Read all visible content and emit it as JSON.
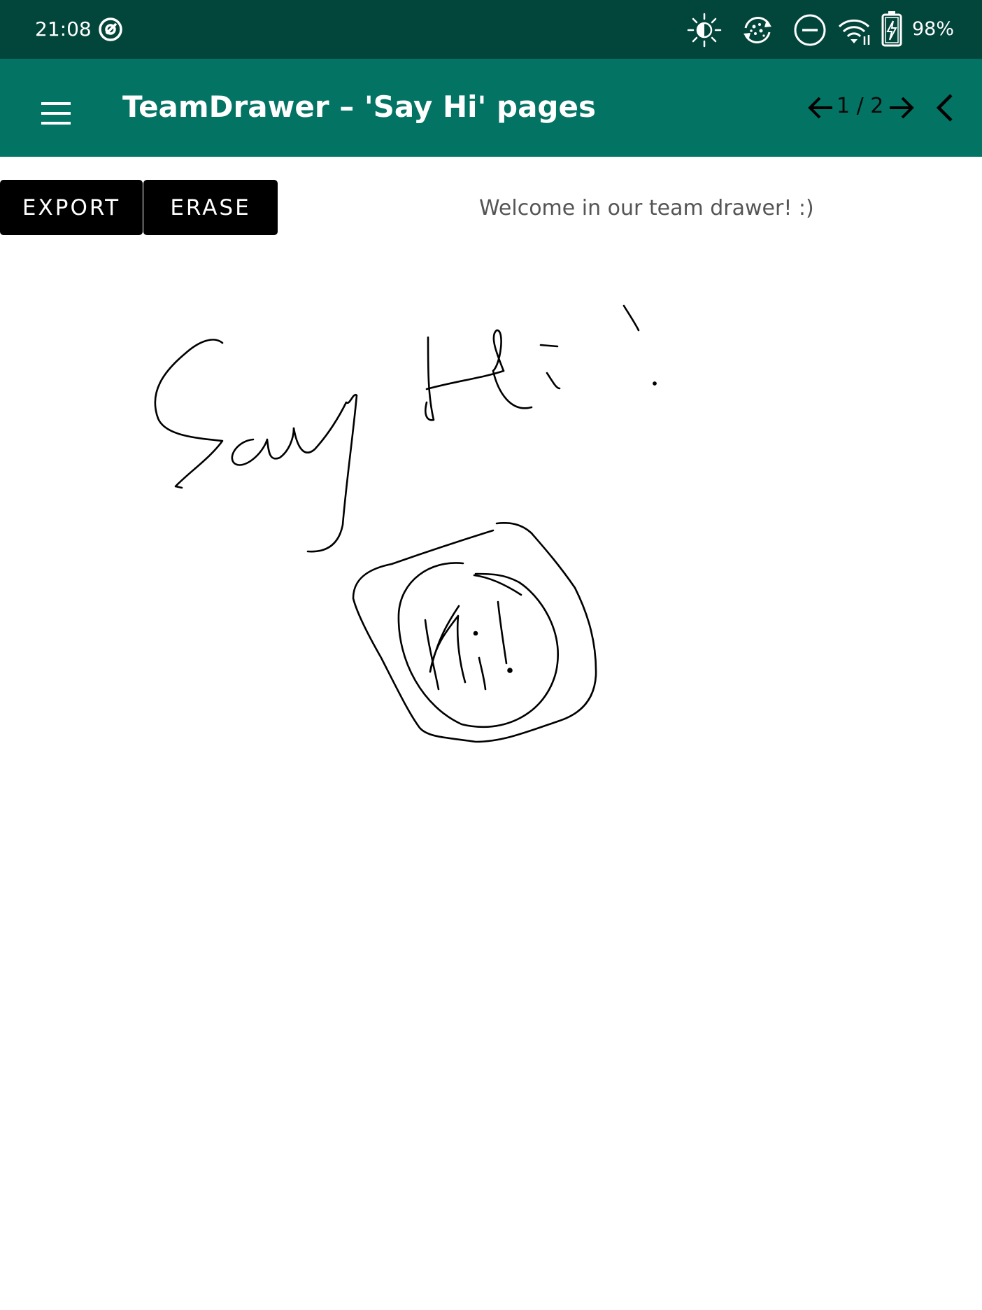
{
  "status_bar": {
    "time": "21:08",
    "battery": "98%",
    "icons": [
      "sync-app-icon",
      "brightness-icon",
      "refresh-screen-icon",
      "do-not-disturb-icon",
      "wifi-icon",
      "battery-charging-icon"
    ]
  },
  "app_bar": {
    "menu_icon": "hamburger-menu-icon",
    "title": "TeamDrawer – 'Say Hi' pages",
    "page_indicator": "1 / 2",
    "nav_icons": [
      "arrow-left-icon",
      "arrow-right-icon",
      "chevron-left-icon"
    ]
  },
  "toolbar": {
    "export_label": "EXPORT",
    "erase_label": "ERASE"
  },
  "welcome_text": "Welcome in our team drawer! :)",
  "colors": {
    "status_bar": "#02453b",
    "app_bar": "#037364",
    "button_bg": "#000000",
    "ink": "#000000"
  }
}
